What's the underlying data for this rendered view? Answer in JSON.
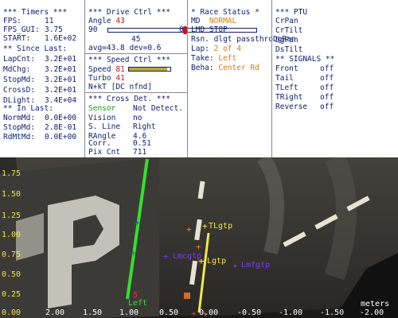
{
  "timers": {
    "header": "*** Timers ***",
    "rows": [
      {
        "k": "FPS:",
        "v": "11"
      },
      {
        "k": "FPS_GUI:",
        "v": "3.75"
      },
      {
        "k": "START:",
        "v": "1.6E+02"
      }
    ],
    "since_header": "** Since Last:",
    "since_rows": [
      {
        "k": "LapCnt:",
        "v": "3.2E+01"
      },
      {
        "k": "MdChg:",
        "v": "3.2E+01"
      },
      {
        "k": "StopMd:",
        "v": "3.2E+01"
      },
      {
        "k": "CrossD:",
        "v": "3.2E+01"
      },
      {
        "k": "DLight:",
        "v": "3.4E+04"
      }
    ],
    "in_header": "** In Last:",
    "in_rows": [
      {
        "k": "NormMd:",
        "v": "0.0E+00"
      },
      {
        "k": "StopMd:",
        "v": "2.8E-01"
      },
      {
        "k": "RdMtMd:",
        "v": "0.0E+00"
      }
    ]
  },
  "drive": {
    "header": "*** Drive Ctrl ***",
    "angle_label": "Angle",
    "angle_value": "43",
    "slider_min": "90",
    "slider_max": "0",
    "slider_center": "45",
    "slider_fraction": 0.52,
    "avg_text": "avg=43.8 dev=0.6"
  },
  "speed": {
    "header": "*** Speed Ctrl ***",
    "speed_label": "Speed",
    "speed_value": "81",
    "speed_fraction": 0.93,
    "turbo_label": "Turbo",
    "turbo_value": "41",
    "nkt": "N+kT [DC nfnd]"
  },
  "cross": {
    "header": "*** Cross Det. ***",
    "rows": [
      {
        "k": "Sensor",
        "v": "Not Detect.",
        "kcolor": "green"
      },
      {
        "k": "Vision",
        "v": "no"
      },
      {
        "k": "S. Line",
        "v": "Right"
      },
      {
        "k": "RAngle",
        "v": "4.6"
      },
      {
        "k": "Corr.",
        "v": "0.51"
      },
      {
        "k": "Pix Cnt",
        "v": "711"
      }
    ]
  },
  "race": {
    "header": "* Race Status *",
    "md_label": "MD",
    "md_value": "NORMAL",
    "lmd_label": "LMD",
    "lmd_value": "STOP",
    "rsn_label": "Rsn.",
    "rsn_value": "dlgt passthroDgRan",
    "lap_label": "Lap:",
    "lap_value": "2 of 4",
    "take_label": "Take:",
    "take_value": "Left",
    "beha_label": "Beha:",
    "beha_value": "Center Rd"
  },
  "ptu": {
    "header": "*** PTU",
    "items": [
      "CrPan",
      "CrTilt",
      "DgPan",
      "DsTilt"
    ]
  },
  "signals": {
    "header": "** SIGNALS **",
    "rows": [
      {
        "k": "Front",
        "v": "off"
      },
      {
        "k": "Tail",
        "v": "off"
      },
      {
        "k": "TLeft",
        "v": "off"
      },
      {
        "k": "TRight",
        "v": "off"
      },
      {
        "k": "Reverse",
        "v": "off"
      }
    ]
  },
  "camera": {
    "y_ticks": [
      "1.75",
      "1.50",
      "1.25",
      "1.00",
      "0.75",
      "0.50",
      "0.25",
      "0.00"
    ],
    "x_ticks": [
      "2.00",
      "1.50",
      "1.00",
      "0.50",
      "0.00",
      "-0.50",
      "-1.00",
      "-1.50",
      "-2.00"
    ],
    "unit": "meters",
    "labels": {
      "left": "Left",
      "lgtp_upper": "TLgtp",
      "lgtp_mid": "Lgtp",
      "lmcgtp": "Lmcgtp",
      "lmfgtp": "Lmfgtp",
      "five": "5"
    },
    "colors": {
      "left_line": "#33e02e",
      "right_line": "#f2e94a",
      "marker_purple": "#7a3cff",
      "marker_blue": "#2b4bff",
      "marker_orange": "#ff7a2a",
      "tick_yellow": "#f3e24a"
    }
  }
}
